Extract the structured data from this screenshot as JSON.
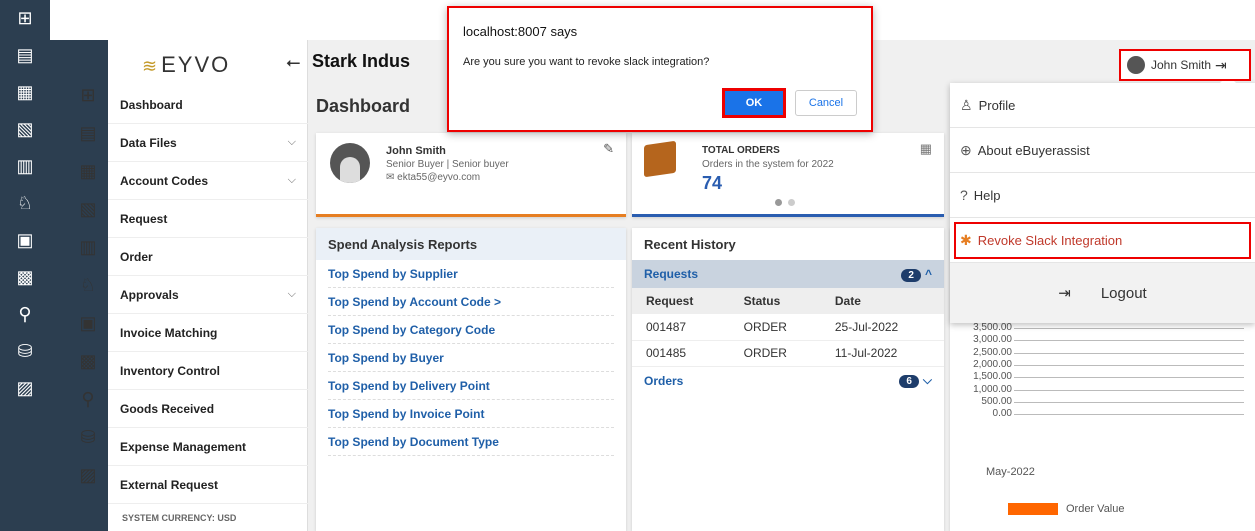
{
  "dialog": {
    "title": "localhost:8007 says",
    "message": "Are you sure you want to revoke slack integration?",
    "ok": "OK",
    "cancel": "Cancel"
  },
  "brand": {
    "logo": "EYVO"
  },
  "header": {
    "company": "Stark Indus",
    "user": "John Smith"
  },
  "sidebar": {
    "items": [
      {
        "label": "Dashboard",
        "chevron": false
      },
      {
        "label": "Data Files",
        "chevron": true
      },
      {
        "label": "Account Codes",
        "chevron": true
      },
      {
        "label": "Request",
        "chevron": false
      },
      {
        "label": "Order",
        "chevron": false
      },
      {
        "label": "Approvals",
        "chevron": true
      },
      {
        "label": "Invoice Matching",
        "chevron": false
      },
      {
        "label": "Inventory Control",
        "chevron": false
      },
      {
        "label": "Goods Received",
        "chevron": false
      },
      {
        "label": "Expense Management",
        "chevron": false
      },
      {
        "label": "External Request",
        "chevron": false
      }
    ],
    "currency": "SYSTEM CURRENCY: USD"
  },
  "main": {
    "title": "Dashboard"
  },
  "user_card": {
    "name": "John Smith",
    "role": "Senior Buyer | Senior buyer",
    "email": "ekta55@eyvo.com"
  },
  "orders_card": {
    "title": "TOTAL ORDERS",
    "subtitle": "Orders in the system for 2022",
    "value": "74"
  },
  "spend": {
    "title": "Spend Analysis Reports",
    "links": [
      "Top Spend by Supplier",
      "Top Spend by Account Code  >",
      "Top Spend by Category Code",
      "Top Spend by Buyer",
      "Top Spend by Delivery Point",
      "Top Spend by Invoice Point",
      "Top Spend by Document Type"
    ]
  },
  "history": {
    "title": "Recent History",
    "requests_label": "Requests",
    "requests_count": "2",
    "columns": [
      "Request",
      "Status",
      "Date"
    ],
    "rows": [
      [
        "001487",
        "ORDER",
        "25-Jul-2022"
      ],
      [
        "001485",
        "ORDER",
        "11-Jul-2022"
      ]
    ],
    "orders_label": "Orders",
    "orders_count": "6"
  },
  "chart_data": {
    "type": "bar",
    "categories": [
      "May-2022"
    ],
    "series": [
      {
        "name": "Order Value",
        "values": [
          0
        ]
      }
    ],
    "y_ticks": [
      "3,500.00",
      "3,000.00",
      "2,500.00",
      "2,000.00",
      "1,500.00",
      "1,000.00",
      "500.00",
      "0.00"
    ],
    "ylim": [
      0,
      3500
    ],
    "colors": [
      "#ff6600"
    ]
  },
  "user_menu": {
    "items": [
      "Profile",
      "About eBuyerassist",
      "Help",
      "Revoke Slack Integration"
    ],
    "logout": "Logout"
  }
}
